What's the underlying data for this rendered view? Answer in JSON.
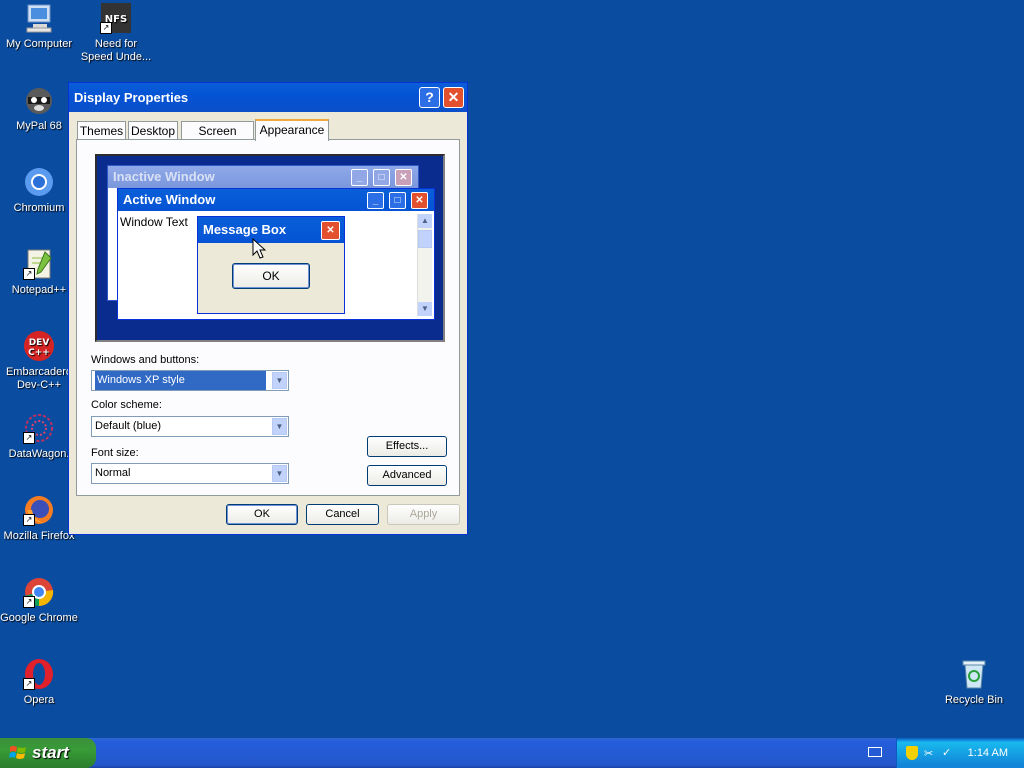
{
  "desktop": {
    "icons": [
      {
        "label": "My Computer",
        "shortcut": false
      },
      {
        "label": "Need for\nSpeed Unde...",
        "shortcut": true
      },
      {
        "label": "MyPal 68",
        "shortcut": false
      },
      {
        "label": "Chromium",
        "shortcut": false
      },
      {
        "label": "Notepad++",
        "shortcut": true
      },
      {
        "label": "Embarcadero\nDev-C++",
        "shortcut": false
      },
      {
        "label": "DataWagon.",
        "shortcut": true
      },
      {
        "label": "Mozilla Firefox",
        "shortcut": true
      },
      {
        "label": "Google Chrome",
        "shortcut": true
      },
      {
        "label": "Opera",
        "shortcut": true
      },
      {
        "label": "Recycle Bin",
        "shortcut": false
      }
    ]
  },
  "dialog": {
    "title": "Display Properties",
    "help_glyph": "?",
    "close_glyph": "✕",
    "tabs": [
      "Themes",
      "Desktop",
      "Screen Saver",
      "Appearance"
    ],
    "active_tab": "Appearance",
    "preview": {
      "inactive_title": "Inactive Window",
      "active_title": "Active Window",
      "window_text": "Window Text",
      "message_title": "Message Box",
      "ok_label": "OK"
    },
    "windows_buttons_label": "Windows and buttons:",
    "windows_buttons_value": "Windows XP style",
    "color_scheme_label": "Color scheme:",
    "color_scheme_value": "Default (blue)",
    "font_size_label": "Font size:",
    "font_size_value": "Normal",
    "effects_label": "Effects...",
    "advanced_label": "Advanced",
    "ok_label": "OK",
    "cancel_label": "Cancel",
    "apply_label": "Apply"
  },
  "taskbar": {
    "start_label": "start",
    "clock": "1:14 AM"
  },
  "colors": {
    "desktop": "#0a4c9f",
    "title_active": "#0453d5",
    "dialog_face": "#ece9d8",
    "start_green": "#379b37"
  }
}
